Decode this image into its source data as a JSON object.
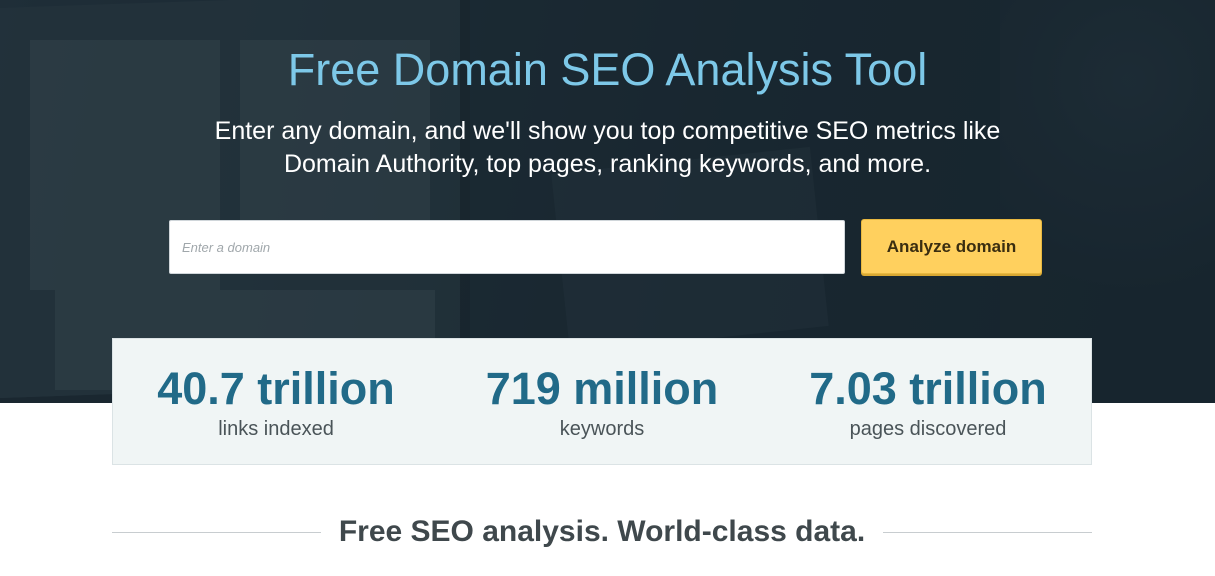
{
  "hero": {
    "title": "Free Domain SEO Analysis Tool",
    "subtitle": "Enter any domain, and we'll show you top competitive SEO metrics like Domain Authority, top pages, ranking keywords, and more.",
    "search": {
      "placeholder": "Enter a domain",
      "value": ""
    },
    "analyze_button": "Analyze domain"
  },
  "stats": [
    {
      "value": "40.7 trillion",
      "label": "links indexed"
    },
    {
      "value": "719 million",
      "label": "keywords"
    },
    {
      "value": "7.03 trillion",
      "label": "pages discovered"
    }
  ],
  "section": {
    "heading": "Free SEO analysis. World-class data."
  },
  "colors": {
    "title": "#7dc8e8",
    "button": "#ffd05e",
    "stat_value": "#216a88",
    "stats_bg": "#f0f5f5"
  }
}
